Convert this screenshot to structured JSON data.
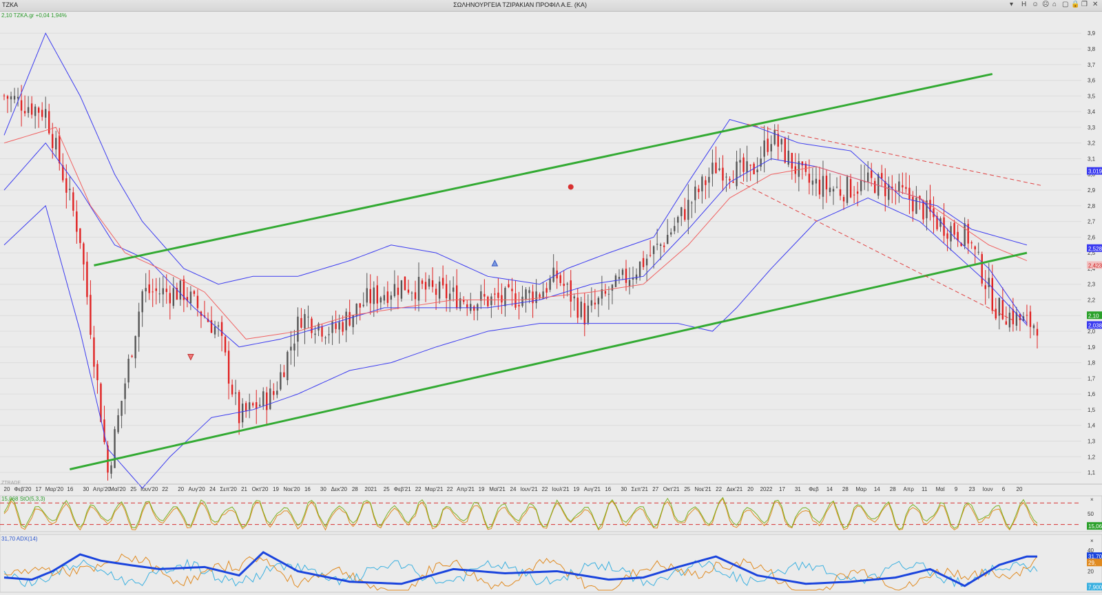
{
  "header": {
    "symbol": "TZKA",
    "title": "ΣΩΛΗΝΟΥΡΓΕΙΑ ΤΖΙΡΑΚΙΑΝ ΠΡΟΦΙΛ Α.Ε. (ΚΑ)",
    "quote": "2,10 TZKA.gr +0,04 1,94%",
    "buttons": [
      "▾",
      "H",
      "☺",
      "☹",
      "⌂",
      "▢",
      "🔒",
      "❐",
      "✕"
    ]
  },
  "watermark": "ZTRADE",
  "colors": {
    "up_candle": "#555555",
    "down_candle": "#e02020",
    "bollinger": "#3a3af0",
    "ma": "#f06060",
    "channel": "#33aa33",
    "stoch_k": "#7ab020",
    "stoch_d": "#e08a20",
    "adx": "#1a44dd",
    "di_plus": "#e08a20",
    "di_minus": "#3ab0e0"
  },
  "chart_data": {
    "type": "candlestick",
    "y_ticks": [
      "3,9",
      "3,8",
      "3,7",
      "3,6",
      "3,5",
      "3,4",
      "3,3",
      "3,2",
      "3,1",
      "3,0",
      "2,9",
      "2,8",
      "2,7",
      "2,6",
      "2,5",
      "2,4",
      "2,3",
      "2,2",
      "2,1",
      "2,0",
      "1,9",
      "1,8",
      "1,7",
      "1,6",
      "1,5",
      "1,4",
      "1,3",
      "1,2",
      "1,1"
    ],
    "ylim": [
      1.03,
      3.98
    ],
    "x_ticks": [
      "20",
      "Φεβ'20",
      "17",
      "Μαρ'20",
      "16",
      "30",
      "Απρ'20",
      "Μαϊ'20",
      "25",
      "Ιουν'20",
      "22",
      "20",
      "Αυγ'20",
      "24",
      "Σεπ'20",
      "21",
      "Οκτ'20",
      "19",
      "Νοε'20",
      "16",
      "30",
      "Δεκ'20",
      "28",
      "2021",
      "25",
      "Φεβ'21",
      "22",
      "Μαρ'21",
      "22",
      "Απρ'21",
      "19",
      "Μαϊ'21",
      "24",
      "Ιουν'21",
      "22",
      "Ιουλ'21",
      "19",
      "Αυγ'21",
      "16",
      "30",
      "Σεπ'21",
      "27",
      "Οκτ'21",
      "25",
      "Νοε'21",
      "22",
      "Δεκ'21",
      "20",
      "2022",
      "17",
      "31",
      "Φεβ",
      "14",
      "28",
      "Μαρ",
      "14",
      "28",
      "Απρ",
      "11",
      "Μαϊ",
      "9",
      "23",
      "Ιουν",
      "6",
      "20"
    ],
    "price_path": [
      [
        0,
        3.5
      ],
      [
        12,
        3.4
      ],
      [
        22,
        2.6
      ],
      [
        30,
        1.1
      ],
      [
        40,
        2.25
      ],
      [
        52,
        2.25
      ],
      [
        62,
        2.0
      ],
      [
        68,
        1.45
      ],
      [
        78,
        1.6
      ],
      [
        86,
        2.1
      ],
      [
        95,
        2.0
      ],
      [
        105,
        2.2
      ],
      [
        115,
        2.3
      ],
      [
        125,
        2.25
      ],
      [
        135,
        2.2
      ],
      [
        145,
        2.2
      ],
      [
        155,
        2.25
      ],
      [
        160,
        2.35
      ],
      [
        168,
        2.1
      ],
      [
        178,
        2.3
      ],
      [
        190,
        2.55
      ],
      [
        198,
        2.8
      ],
      [
        206,
        3.05
      ],
      [
        216,
        3.0
      ],
      [
        222,
        3.25
      ],
      [
        232,
        2.95
      ],
      [
        242,
        2.9
      ],
      [
        252,
        2.95
      ],
      [
        262,
        2.85
      ],
      [
        270,
        2.7
      ],
      [
        279,
        2.6
      ],
      [
        287,
        2.15
      ],
      [
        296,
        2.05
      ]
    ],
    "volatility": 0.08,
    "last_price": 2.1,
    "bollinger": {
      "upper": [
        [
          0,
          3.25
        ],
        [
          12,
          3.9
        ],
        [
          22,
          3.5
        ],
        [
          32,
          3.0
        ],
        [
          40,
          2.7
        ],
        [
          52,
          2.4
        ],
        [
          62,
          2.3
        ],
        [
          72,
          2.35
        ],
        [
          85,
          2.35
        ],
        [
          100,
          2.45
        ],
        [
          112,
          2.55
        ],
        [
          125,
          2.5
        ],
        [
          140,
          2.35
        ],
        [
          155,
          2.3
        ],
        [
          163,
          2.4
        ],
        [
          175,
          2.5
        ],
        [
          188,
          2.6
        ],
        [
          198,
          2.95
        ],
        [
          210,
          3.35
        ],
        [
          218,
          3.3
        ],
        [
          230,
          3.2
        ],
        [
          245,
          3.15
        ],
        [
          260,
          2.85
        ],
        [
          270,
          2.8
        ],
        [
          280,
          2.65
        ],
        [
          296,
          2.55
        ]
      ],
      "middle": [
        [
          0,
          2.9
        ],
        [
          12,
          3.2
        ],
        [
          22,
          2.9
        ],
        [
          32,
          2.55
        ],
        [
          42,
          2.45
        ],
        [
          55,
          2.15
        ],
        [
          68,
          1.9
        ],
        [
          80,
          1.95
        ],
        [
          95,
          2.05
        ],
        [
          110,
          2.15
        ],
        [
          125,
          2.15
        ],
        [
          140,
          2.15
        ],
        [
          155,
          2.2
        ],
        [
          170,
          2.3
        ],
        [
          185,
          2.35
        ],
        [
          198,
          2.65
        ],
        [
          210,
          2.95
        ],
        [
          222,
          3.1
        ],
        [
          235,
          3.05
        ],
        [
          250,
          2.95
        ],
        [
          265,
          2.85
        ],
        [
          275,
          2.6
        ],
        [
          285,
          2.4
        ],
        [
          296,
          2.05
        ]
      ],
      "lower": [
        [
          0,
          2.55
        ],
        [
          12,
          2.8
        ],
        [
          22,
          2.0
        ],
        [
          30,
          1.25
        ],
        [
          40,
          1.0
        ],
        [
          48,
          1.2
        ],
        [
          60,
          1.45
        ],
        [
          72,
          1.5
        ],
        [
          85,
          1.6
        ],
        [
          100,
          1.75
        ],
        [
          112,
          1.8
        ],
        [
          125,
          1.9
        ],
        [
          140,
          2.0
        ],
        [
          155,
          2.05
        ],
        [
          170,
          2.05
        ],
        [
          185,
          2.05
        ],
        [
          195,
          2.05
        ],
        [
          205,
          2.0
        ],
        [
          212,
          2.15
        ],
        [
          222,
          2.4
        ],
        [
          235,
          2.7
        ],
        [
          250,
          2.85
        ],
        [
          265,
          2.7
        ],
        [
          275,
          2.5
        ],
        [
          285,
          2.3
        ],
        [
          296,
          2.04
        ]
      ],
      "upper_label": "3,019",
      "middle_label": "2,5283",
      "lower_label": "2,038"
    },
    "moving_average": {
      "path": [
        [
          0,
          3.2
        ],
        [
          15,
          3.3
        ],
        [
          25,
          2.8
        ],
        [
          35,
          2.5
        ],
        [
          45,
          2.4
        ],
        [
          58,
          2.25
        ],
        [
          70,
          1.95
        ],
        [
          85,
          2.0
        ],
        [
          100,
          2.1
        ],
        [
          115,
          2.15
        ],
        [
          130,
          2.2
        ],
        [
          150,
          2.2
        ],
        [
          170,
          2.25
        ],
        [
          185,
          2.3
        ],
        [
          198,
          2.55
        ],
        [
          210,
          2.85
        ],
        [
          222,
          3.0
        ],
        [
          235,
          3.05
        ],
        [
          250,
          2.95
        ],
        [
          265,
          2.85
        ],
        [
          275,
          2.7
        ],
        [
          285,
          2.55
        ],
        [
          296,
          2.45
        ]
      ],
      "label": "2,4233"
    },
    "price_label": "2,10",
    "channel": {
      "upper_line": [
        [
          26,
          2.42
        ],
        [
          286,
          3.64
        ]
      ],
      "lower_line": [
        [
          19,
          1.12
        ],
        [
          296,
          2.5
        ]
      ],
      "resistance_dashed": [
        [
          215,
          3.32
        ],
        [
          300,
          2.93
        ]
      ],
      "support_dashed": [
        [
          213,
          2.95
        ],
        [
          292,
          2.07
        ]
      ]
    },
    "signals": [
      {
        "x": 164,
        "y": 2.92,
        "kind": "sell-marker"
      },
      {
        "x": 142,
        "y": 2.43,
        "kind": "up-triangle"
      },
      {
        "x": 54,
        "y": 1.84,
        "kind": "down-triangle"
      }
    ],
    "stochastic": {
      "title": "15,068 StO(5,3,3)",
      "levels": [
        80,
        20
      ],
      "ticks": [
        "50"
      ],
      "ylim": [
        0,
        100
      ],
      "cycles": 72,
      "last_value": "15,068"
    },
    "adx": {
      "title": "31,70 ADX(14)",
      "ticks": [
        "40",
        "20"
      ],
      "ylim": [
        0,
        55
      ],
      "adx_path": [
        [
          0,
          14
        ],
        [
          8,
          12
        ],
        [
          14,
          20
        ],
        [
          22,
          36
        ],
        [
          28,
          30
        ],
        [
          36,
          26
        ],
        [
          45,
          22
        ],
        [
          58,
          24
        ],
        [
          68,
          16
        ],
        [
          75,
          38
        ],
        [
          85,
          20
        ],
        [
          100,
          10
        ],
        [
          115,
          8
        ],
        [
          130,
          22
        ],
        [
          145,
          18
        ],
        [
          160,
          20
        ],
        [
          175,
          12
        ],
        [
          185,
          14
        ],
        [
          195,
          24
        ],
        [
          206,
          34
        ],
        [
          218,
          16
        ],
        [
          232,
          8
        ],
        [
          245,
          10
        ],
        [
          258,
          14
        ],
        [
          268,
          22
        ],
        [
          278,
          6
        ],
        [
          288,
          26
        ],
        [
          296,
          34
        ]
      ],
      "adx_label": "31,70",
      "di_label": "29,",
      "dim_label": "7,900"
    },
    "n_bars": 300
  }
}
